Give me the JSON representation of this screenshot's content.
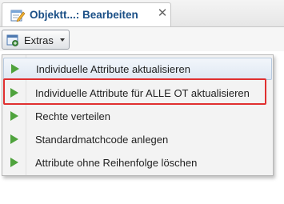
{
  "tab": {
    "title": "Objektt...: Bearbeiten",
    "icon": "edit-form-icon",
    "close_glyph": "✕"
  },
  "toolbar": {
    "extras_label": "Extras",
    "extras_icon": "extras-icon"
  },
  "menu": {
    "items": [
      {
        "label": "Individuelle Attribute aktualisieren",
        "icon": "green-arrow-icon"
      },
      {
        "label": "Individuelle Attribute für ALLE OT aktualisieren",
        "icon": "green-arrow-icon"
      },
      {
        "label": "Rechte verteilen",
        "icon": "green-arrow-icon"
      },
      {
        "label": "Standardmatchcode anlegen",
        "icon": "green-arrow-icon"
      },
      {
        "label": "Attribute ohne Reihenfolge löschen",
        "icon": "green-arrow-icon"
      }
    ]
  },
  "colors": {
    "highlight": "#e03030",
    "arrow": "#4fa33d",
    "tab_title": "#1a4f86"
  }
}
